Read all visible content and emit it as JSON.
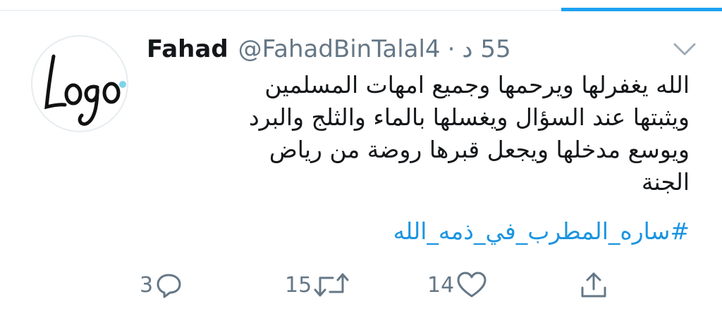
{
  "tweet": {
    "name": "Fahad",
    "handle": "@FahadBinTalal4",
    "separator": "·",
    "time": "55 د",
    "avatar_logo_text": "Logo",
    "body_lines": [
      "الله يغفرلها ويرحمها وجميع امهات المسلمين",
      "ويثبتها عند السؤال ويغسلها بالماء والثلج والبرد",
      "ويوسع مدخلها ويجعل قبرها روضة من رياض",
      "الجنة"
    ],
    "hashtag": "#ساره_المطرب_في_ذمه_الله"
  },
  "actions": {
    "reply_count": "3",
    "retweet_count": "15",
    "like_count": "14"
  },
  "icons": {
    "reply": "reply-bubble-icon",
    "retweet": "retweet-icon",
    "like": "heart-icon",
    "share": "share-icon",
    "menu": "chevron-down-icon"
  },
  "colors": {
    "accent": "#1da1f2",
    "hashtag": "#1b95e0",
    "secondary_text": "#657786",
    "logo_dot": "#7fd3e8"
  }
}
